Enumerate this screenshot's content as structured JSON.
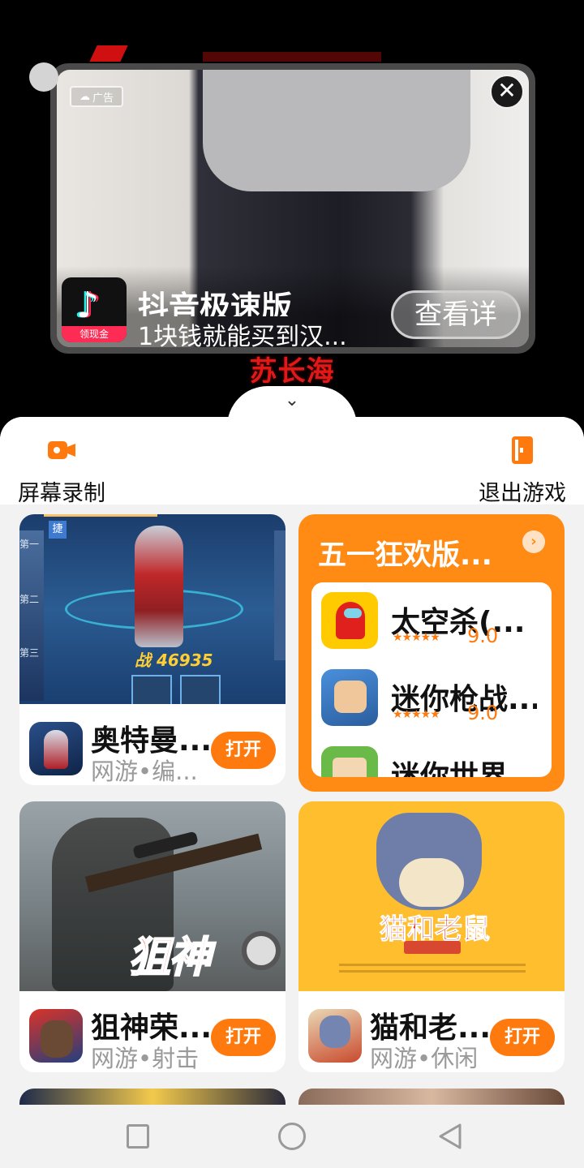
{
  "video": {
    "caption": "苏长海"
  },
  "ad": {
    "badge": "广告",
    "close_label": "✕",
    "app_name": "抖音极速版",
    "tagline": "1块钱就能买到汉...",
    "cta": "查看详",
    "logo_tag": "领现金"
  },
  "sheet": {
    "collapse_icon": "⌄",
    "tools": [
      {
        "label": "屏幕录制"
      },
      {
        "label": "退出游戏"
      }
    ]
  },
  "cards": [
    {
      "name": "奥特曼...",
      "meta": "网游•编...",
      "open": "打开",
      "banner_score": "战 46935",
      "banner_tag": "捷"
    },
    {
      "name": "狙神荣...",
      "meta": "网游•射击",
      "open": "打开",
      "banner_text": "狙神"
    },
    {
      "name": "猫和老...",
      "meta": "网游•休闲",
      "open": "打开",
      "banner_text": "猫和老鼠"
    }
  ],
  "promo": {
    "title": "五一狂欢版...",
    "arrow": "›",
    "items": [
      {
        "name": "太空杀(...",
        "stars": "★★★★★",
        "rating": "9.0"
      },
      {
        "name": "迷你枪战...",
        "stars": "★★★★★",
        "rating": "9.0"
      },
      {
        "name": "迷你世界...",
        "stars": "",
        "rating": ""
      }
    ]
  },
  "ultra_rows": [
    "第一",
    "第二",
    "第三"
  ]
}
